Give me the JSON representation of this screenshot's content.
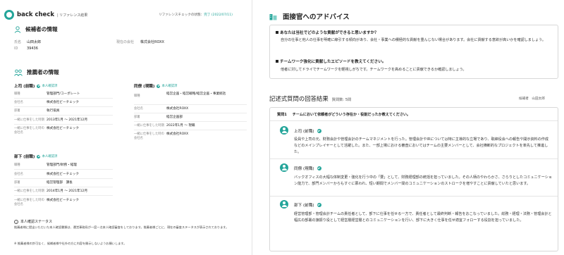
{
  "header": {
    "logo": "back check",
    "subtitle": "| リファレンス結果",
    "status_label": "リファレンスチェックの状態：",
    "status_value": "完了 (2022/07/11)"
  },
  "candidate": {
    "section_title": "候補者の情報",
    "name_label": "氏名",
    "name_value": "山田太郎",
    "id_label": "ID",
    "id_value": "39436",
    "company_label": "現在の会社",
    "company_value": "株式会社ROXX"
  },
  "referees": {
    "section_title": "推薦者の情報",
    "groups": [
      {
        "title": "上司 (前職)",
        "badge": "本人確認済",
        "rows": [
          {
            "k": "職種",
            "v": "管理部門/コーポレート"
          },
          {
            "k": "会社名",
            "v": "株式会社ビーチェック"
          },
          {
            "k": "部署",
            "v": "執行役員"
          },
          {
            "k": "一緒に仕事をした時期",
            "v": "2013年1月 〜 2021年12月"
          },
          {
            "k": "一緒に仕事をした時の会社名",
            "v": "株式会社ビーチェック"
          }
        ]
      },
      {
        "title": "同僚 (現職)",
        "badge": "本人確認済",
        "rows": [
          {
            "k": "職種",
            "v": "経営企画・経営戦略/経営企画・事業統括"
          },
          {
            "k": "会社名",
            "v": "株式会社ROXX"
          },
          {
            "k": "部署",
            "v": "経営企画部"
          },
          {
            "k": "一緒に仕事をした時期",
            "v": "2022年1月 〜 現職"
          },
          {
            "k": "一緒に仕事をした時の会社名",
            "v": "株式会社ROXX"
          }
        ]
      },
      {
        "title": "部下 (前職)",
        "badge": "本人確認済",
        "rows": [
          {
            "k": "職種",
            "v": "管理部門/財務・経理"
          },
          {
            "k": "会社名",
            "v": "株式会社ビーチェック"
          },
          {
            "k": "部署",
            "v": "経営管理部　課長"
          },
          {
            "k": "一緒に仕事をした時期",
            "v": "2014年1月 〜 2021年12月"
          },
          {
            "k": "一緒に仕事をした時の会社名",
            "v": "株式会社ビーチェック"
          }
        ]
      }
    ],
    "note_title": "本人確認ステータス",
    "note_text": "推薦者様に提出いただいた本人確認書類は、運営事務局が一度一点本人確認審査をしております。推薦者様ごとに、現在の審査ステータスが表示されております。",
    "footnote": "※ 推薦者様の許可なく、候補者様や社外の方に内容を開示しないようお願いします。"
  },
  "advice": {
    "title": "面接官へのアドバイス",
    "items": [
      {
        "q": "あなたは当社でどのような貢献ができると思いますか？",
        "a": "自分の仕事と他人の仕事を明確に線引する傾向があり、会社・事業への積極的な貢献を重んじない場合があります。会社に貢献する意欲が高いかを確認しましょう。"
      },
      {
        "q": "チームワーク強化に貢献したエピソードを教えてください。",
        "a": "他者に対してドライでチームワークを軽視しがちです。チームワークを高めることに貢献できるか確認しましょう。"
      }
    ]
  },
  "results": {
    "title": "記述式質問の回答結果",
    "count": "質問数: 5問",
    "respondent_label": "候補者",
    "respondent_name": "山田太郎",
    "question_no": "質問1",
    "question_text": "チームにおいて依頼者がどういう存在か・役割だったか教えてください。",
    "answers": [
      {
        "role": "上司 (前職)",
        "text": "役員や上司の元、財務会計や管理会計のチームマネジメントを行った。管理会計やIRについては特に主導的な立場であり、取締役会への報告や開示資料の作成などのメインプレイヤーとして活躍した。また、一部上場における審査においてはチームの主要メンバーとして、会社横断的なプロジェクトを率先して推進した。"
      },
      {
        "role": "同僚 (現職)",
        "text": "バックオフィスの大幅な体制変更・強化を行う中の「要」として、財務経理部の統括を担っていました。その人柄のやわらかさ、さらりとしたコミュニケーション能力で、部門メンバーからもすぐに慕われ、短い期間でメンバー間のコミュニケーションのストロークを増やすことに貢献していたと思います。"
      },
      {
        "role": "部下 (前職)",
        "text": "経営管理部・管理会計チームの責任者として、部下に仕事を任せる一方で、責任者として最終判断・報告をおこなっていました。総務・経理・法務・管理会計と幅広の部署の旗振り役として経営層経営層とのコミュニケーションを行い、部下に大きく仕事を任せ適宜フォローする役割を担っていました。"
      }
    ]
  },
  "colors": {
    "accent": "#24a59a",
    "text": "#222222",
    "border": "#d8d8d8"
  }
}
